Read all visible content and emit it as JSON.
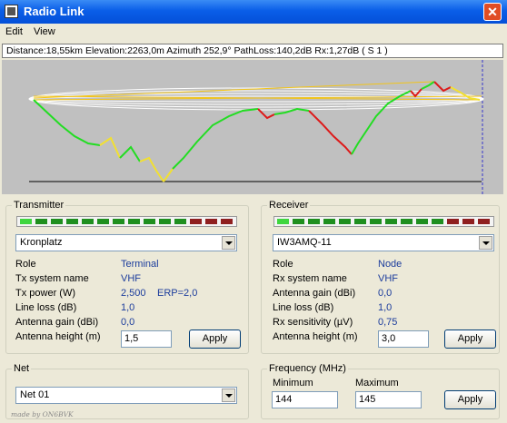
{
  "window": {
    "title": "Radio Link"
  },
  "menu": [
    "Edit",
    "View"
  ],
  "info": "Distance:18,55km  Elevation:2263,0m  Azimuth 252,9°  PathLoss:140,2dB  Rx:1,27dB  ( S 1 )",
  "transmitter": {
    "title": "Transmitter",
    "led_colors": [
      "#3fd63f",
      "#1f8f1f",
      "#1f8f1f",
      "#1f8f1f",
      "#1f8f1f",
      "#1f8f1f",
      "#1f8f1f",
      "#1f8f1f",
      "#1f8f1f",
      "#1f8f1f",
      "#1f8f1f",
      "#8f1f1f",
      "#8f1f1f",
      "#8f1f1f"
    ],
    "site": "Kronplatz",
    "labels": [
      "Role",
      "Tx system name",
      "Tx power (W)",
      "Line loss (dB)",
      "Antenna gain (dBi)",
      "Antenna height (m)"
    ],
    "role": "Terminal",
    "system": "VHF",
    "power": "2,500",
    "erp": "ERP=2,0",
    "line_loss": "1,0",
    "antenna_gain": "0,0",
    "antenna_height": "1,5",
    "apply": "Apply"
  },
  "receiver": {
    "title": "Receiver",
    "led_colors": [
      "#3fd63f",
      "#1f8f1f",
      "#1f8f1f",
      "#1f8f1f",
      "#1f8f1f",
      "#1f8f1f",
      "#1f8f1f",
      "#1f8f1f",
      "#1f8f1f",
      "#1f8f1f",
      "#1f8f1f",
      "#8f1f1f",
      "#8f1f1f",
      "#8f1f1f"
    ],
    "site": "IW3AMQ-11",
    "labels": [
      "Role",
      "Rx system name",
      "Antenna gain (dBi)",
      "Line loss (dB)",
      "Rx sensitivity (µV)",
      "Antenna height (m)"
    ],
    "role": "Node",
    "system": "VHF",
    "antenna_gain": "0,0",
    "line_loss": "1,0",
    "sensitivity": "0,75",
    "antenna_height": "3,0",
    "apply": "Apply"
  },
  "net": {
    "title": "Net",
    "value": "Net 01"
  },
  "frequency": {
    "title": "Frequency (MHz)",
    "min_label": "Minimum",
    "max_label": "Maximum",
    "min": "144",
    "max": "145",
    "apply": "Apply"
  },
  "credit": "made by ON6BVK",
  "colors": {
    "clear": "#22dd22",
    "marginal": "#f2e030",
    "obstructed": "#dd1a1a",
    "fresnel": "#ffffff",
    "beam": "#f2c418",
    "background": "#c0c0c0"
  }
}
